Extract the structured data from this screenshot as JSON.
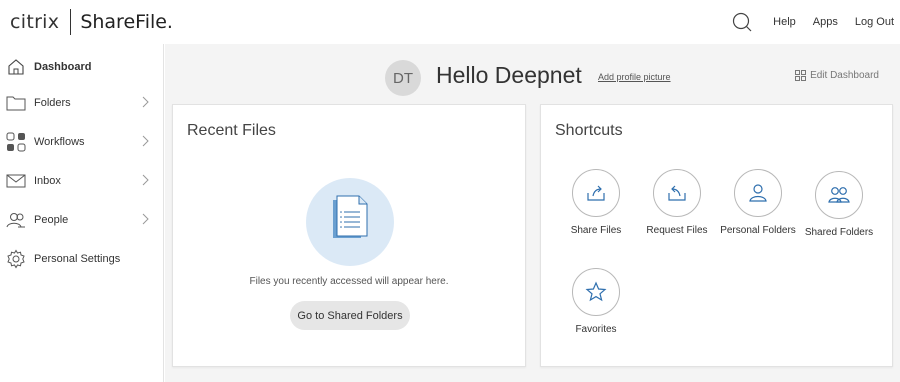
{
  "header": {
    "brand": "citrix",
    "product": "ShareFile.",
    "nav": [
      "Help",
      "Apps",
      "Log Out"
    ]
  },
  "sidebar": {
    "items": [
      {
        "label": "Dashboard",
        "icon": "home-icon",
        "active": true
      },
      {
        "label": "Folders",
        "icon": "folder-icon",
        "chevron": true
      },
      {
        "label": "Workflows",
        "icon": "workflows-icon",
        "chevron": true
      },
      {
        "label": "Inbox",
        "icon": "mail-icon",
        "chevron": true
      },
      {
        "label": "People",
        "icon": "people-icon",
        "chevron": true
      },
      {
        "label": "Personal Settings",
        "icon": "gear-icon"
      }
    ]
  },
  "main": {
    "avatar_initials": "DT",
    "greeting": "Hello Deepnet",
    "add_profile_picture": "Add profile picture",
    "edit_dashboard": "Edit Dashboard",
    "recent_files": {
      "title": "Recent Files",
      "empty_text": "Files you recently accessed will appear here.",
      "button": "Go to Shared Folders"
    },
    "shortcuts": {
      "title": "Shortcuts",
      "items": [
        {
          "label": "Share Files",
          "icon": "share-icon"
        },
        {
          "label": "Request Files",
          "icon": "request-icon"
        },
        {
          "label": "Personal Folders",
          "icon": "person-icon"
        },
        {
          "label": "Shared Folders",
          "icon": "people-icon"
        },
        {
          "label": "Favorites",
          "icon": "star-icon"
        }
      ]
    }
  },
  "colors": {
    "accent": "#2f6fae",
    "illustration_bg": "#dbe9f6",
    "main_bg": "#f4f4f4"
  }
}
